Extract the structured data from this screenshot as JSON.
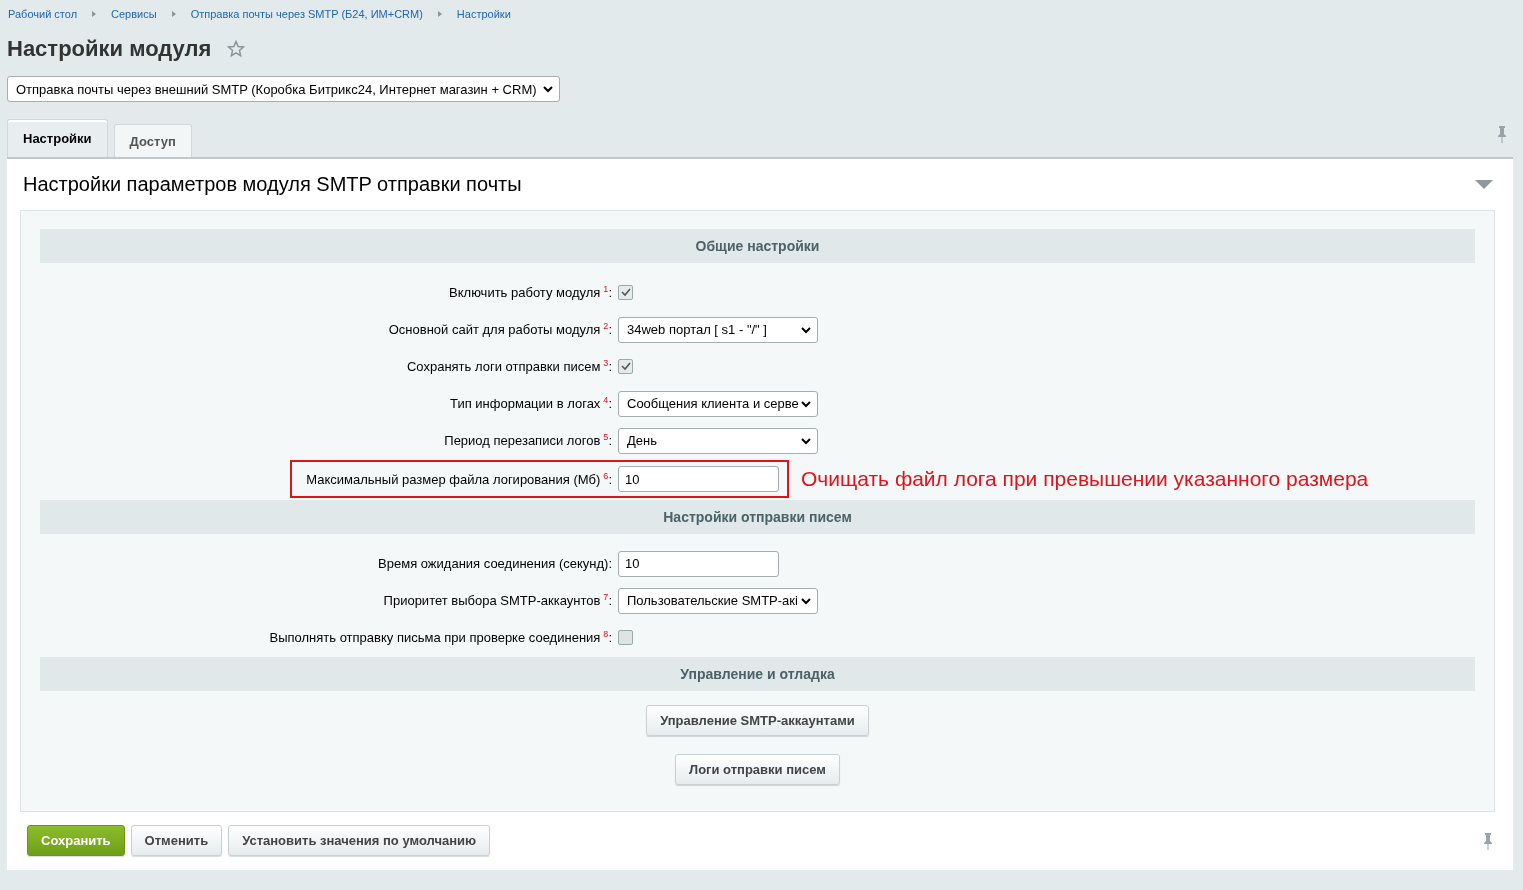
{
  "breadcrumbs": [
    "Рабочий стол",
    "Сервисы",
    "Отправка почты через SMTP (Б24, ИМ+CRM)",
    "Настройки"
  ],
  "title": "Настройки модуля",
  "module_select": {
    "value": "Отправка почты через внешний SMTP (Коробка Битрикс24, Интернет магазин + CRM)"
  },
  "tabs": [
    {
      "label": "Настройки",
      "selected": true
    },
    {
      "label": "Доступ",
      "selected": false
    }
  ],
  "panel_title": "Настройки параметров модуля SMTP отправки почты",
  "sections": [
    {
      "title": "Общие настройки",
      "rows": [
        {
          "kind": "checkbox",
          "label": "Включить работу модуля",
          "note": "1",
          "suffix": ":",
          "checked": true
        },
        {
          "kind": "select",
          "label": "Основной сайт для работы модуля",
          "note": "2",
          "suffix": ":",
          "value": "34web портал [ s1 - \"/\" ]"
        },
        {
          "kind": "checkbox",
          "label": "Сохранять логи отправки писем",
          "note": "3",
          "suffix": ":",
          "checked": true
        },
        {
          "kind": "select",
          "label": "Тип информации в логах",
          "note": "4",
          "suffix": ":",
          "value": "Сообщения клиента и серве"
        },
        {
          "kind": "select",
          "label": "Период перезаписи логов",
          "note": "5",
          "suffix": ":",
          "value": "День"
        },
        {
          "kind": "text",
          "label": "Максимальный размер файла логирования (Мб)",
          "note": "6",
          "suffix": ":",
          "value": "10",
          "highlighted": true,
          "annotation": "Очищать файл лога при превышении указанного размера"
        }
      ]
    },
    {
      "title": "Настройки отправки писем",
      "rows": [
        {
          "kind": "text",
          "label": "Время ожидания соединения (секунд):",
          "value": "10"
        },
        {
          "kind": "select",
          "label": "Приоритет выбора SMTP-аккаунтов",
          "note": "7",
          "suffix": ":",
          "value": "Пользовательские SMTP-акі"
        },
        {
          "kind": "checkbox",
          "label": "Выполнять отправку письма при проверке соединения",
          "note": "8",
          "suffix": ":",
          "checked": false
        }
      ]
    },
    {
      "title": "Управление и отладка",
      "buttons": [
        "Управление SMTP-аккаунтами",
        "Логи отправки писем"
      ]
    }
  ],
  "footer_buttons": [
    {
      "kind": "primary",
      "label": "Сохранить"
    },
    {
      "kind": "normal",
      "label": "Отменить"
    },
    {
      "kind": "normal",
      "label": "Установить значения по умолчанию"
    }
  ]
}
